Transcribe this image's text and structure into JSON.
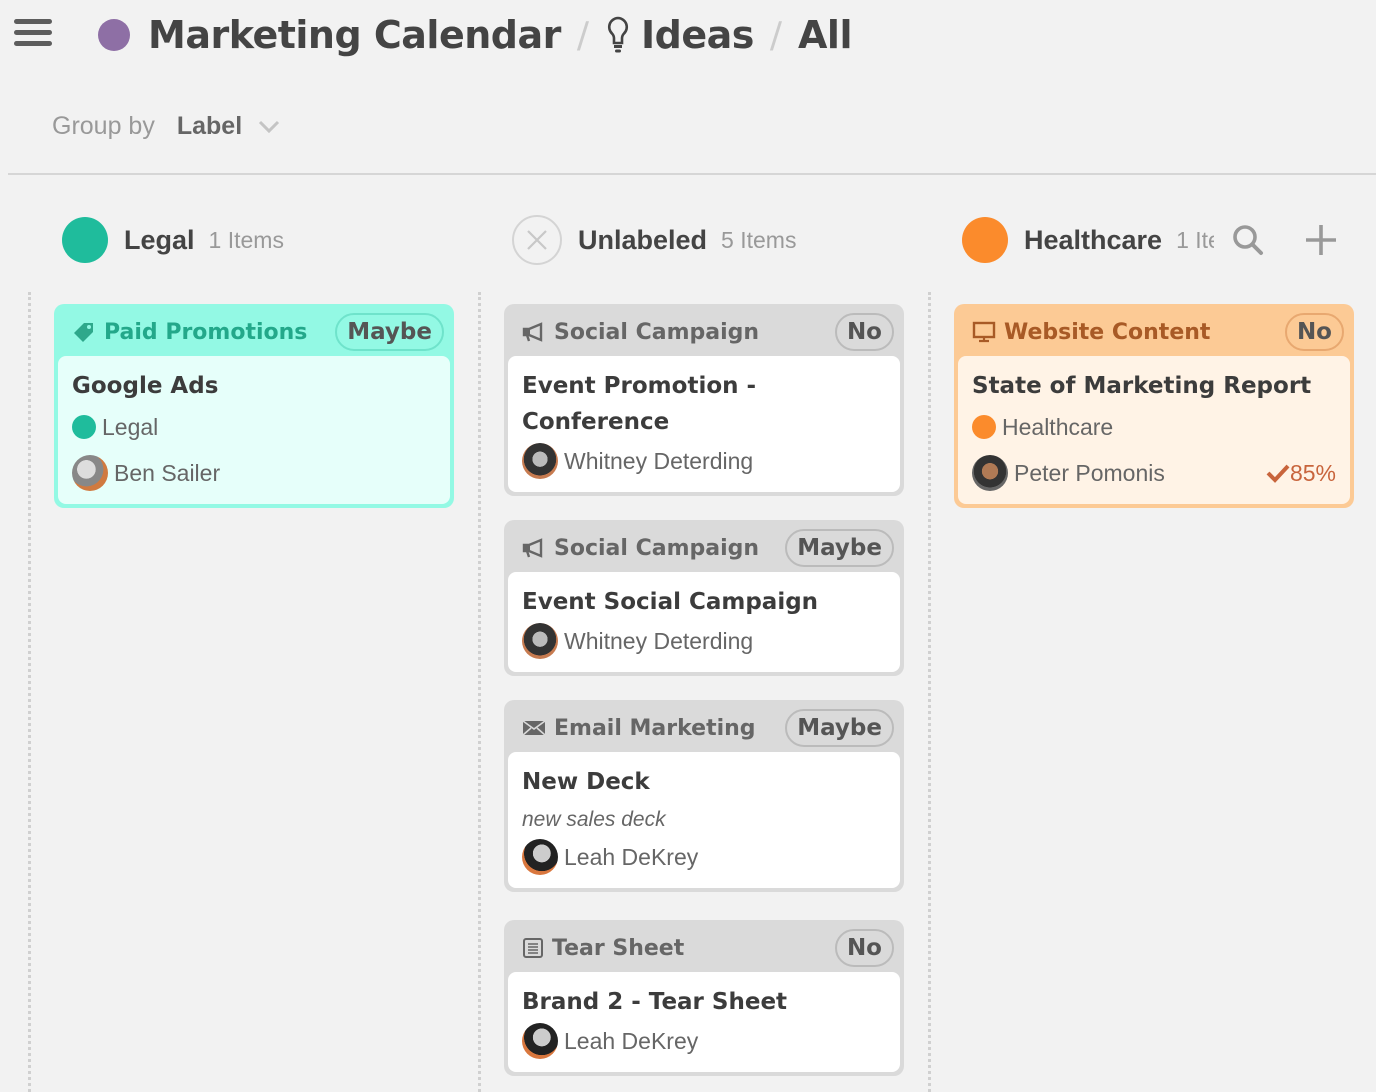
{
  "header": {
    "project_color": "#8e6fa5",
    "project": "Marketing Calendar",
    "section": "Ideas",
    "view": "All",
    "separator": "/"
  },
  "toolbar": {
    "group_by_label": "Group by",
    "group_by_value": "Label"
  },
  "columns": [
    {
      "title": "Legal",
      "count": "1 Items",
      "color": "#1fbc9c",
      "cards": [
        {
          "category": "Paid Promotions",
          "category_icon": "tag-icon",
          "status": "Maybe",
          "title": "Google Ads",
          "label": "Legal",
          "label_color": "#1fbc9c",
          "assignee": "Ben Sailer"
        }
      ]
    },
    {
      "title": "Unlabeled",
      "count": "5 Items",
      "color": "#d4d4d4",
      "cards": [
        {
          "category": "Social Campaign",
          "category_icon": "megaphone-icon",
          "status": "No",
          "title_line1": "Event Promotion -",
          "title_line2": "Conference",
          "assignee": "Whitney Deterding"
        },
        {
          "category": "Social Campaign",
          "category_icon": "megaphone-icon",
          "status": "Maybe",
          "title": "Event Social Campaign",
          "assignee": "Whitney Deterding"
        },
        {
          "category": "Email Marketing",
          "category_icon": "envelope-icon",
          "status": "Maybe",
          "title": "New Deck",
          "description": "new sales deck",
          "assignee": "Leah DeKrey"
        },
        {
          "category": "Tear Sheet",
          "category_icon": "document-icon",
          "status": "No",
          "title": "Brand 2 - Tear Sheet",
          "assignee": "Leah DeKrey"
        }
      ]
    },
    {
      "title": "Healthcare",
      "count": "1 Ite",
      "color": "#fb8b2c",
      "cards": [
        {
          "category": "Website Content",
          "category_icon": "monitor-icon",
          "status": "No",
          "title": "State of Marketing Report",
          "label": "Healthcare",
          "label_color": "#fb8b2c",
          "assignee": "Peter Pomonis",
          "progress": "85%"
        }
      ]
    }
  ]
}
